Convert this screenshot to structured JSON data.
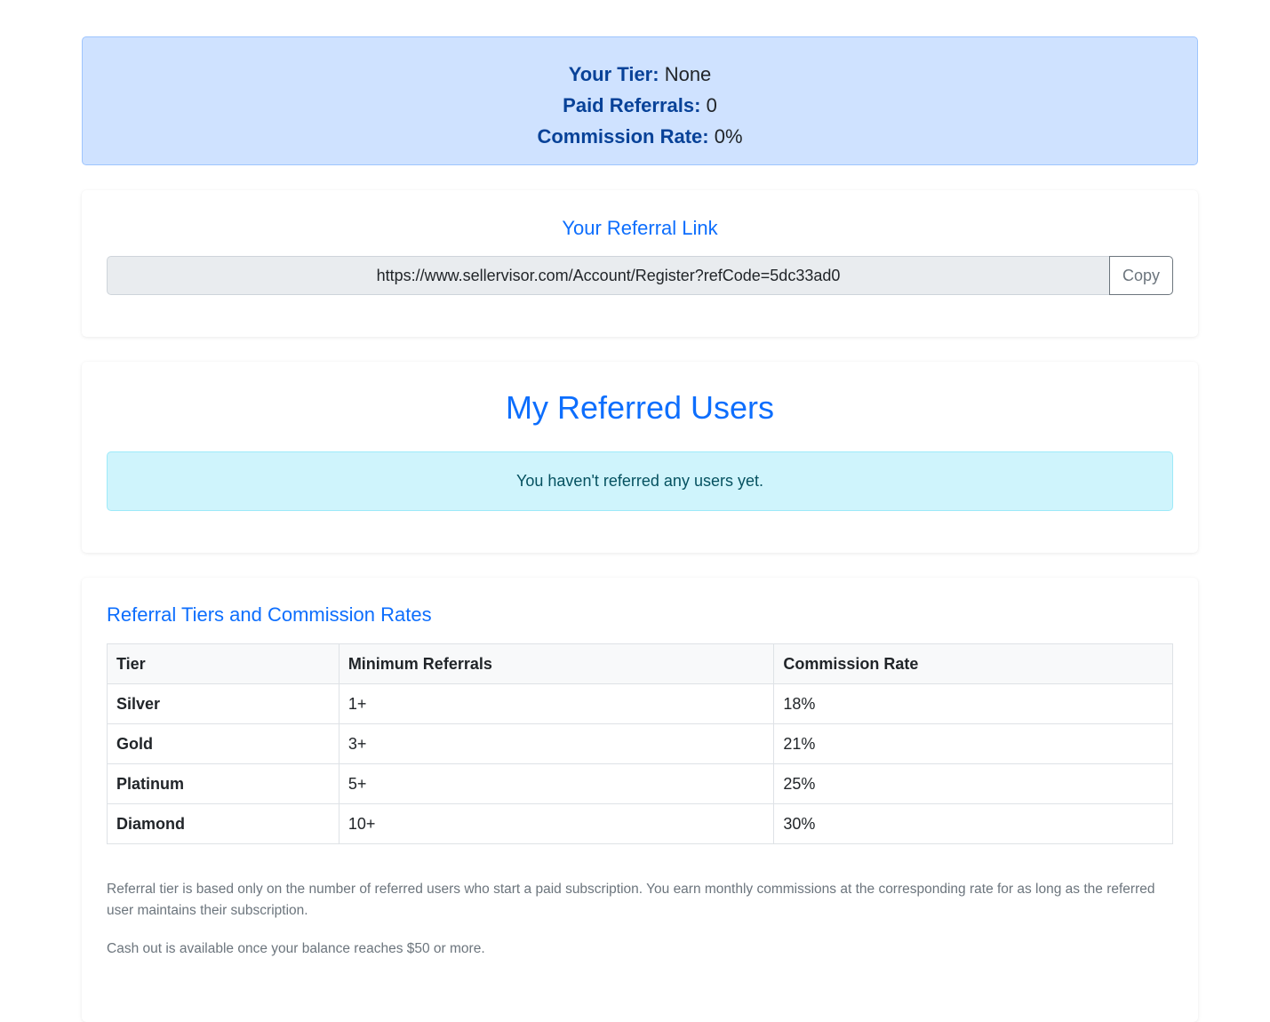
{
  "summary": {
    "tier_label": "Your Tier:",
    "tier_value": "None",
    "paid_referrals_label": "Paid Referrals:",
    "paid_referrals_value": "0",
    "commission_rate_label": "Commission Rate:",
    "commission_rate_value": "0%"
  },
  "referral_link": {
    "title": "Your Referral Link",
    "url": "https://www.sellervisor.com/Account/Register?refCode=5dc33ad0",
    "copy_label": "Copy"
  },
  "referred_users": {
    "title": "My Referred Users",
    "empty_message": "You haven't referred any users yet."
  },
  "tiers": {
    "title": "Referral Tiers and Commission Rates",
    "columns": [
      "Tier",
      "Minimum Referrals",
      "Commission Rate"
    ],
    "rows": [
      {
        "tier": "Silver",
        "min": "1+",
        "rate": "18%"
      },
      {
        "tier": "Gold",
        "min": "3+",
        "rate": "21%"
      },
      {
        "tier": "Platinum",
        "min": "5+",
        "rate": "25%"
      },
      {
        "tier": "Diamond",
        "min": "10+",
        "rate": "30%"
      }
    ],
    "note_1": "Referral tier is based only on the number of referred users who start a paid subscription. You earn monthly commissions at the corresponding rate for as long as the referred user maintains their subscription.",
    "note_2": "Cash out is available once your balance reaches $50 or more."
  }
}
